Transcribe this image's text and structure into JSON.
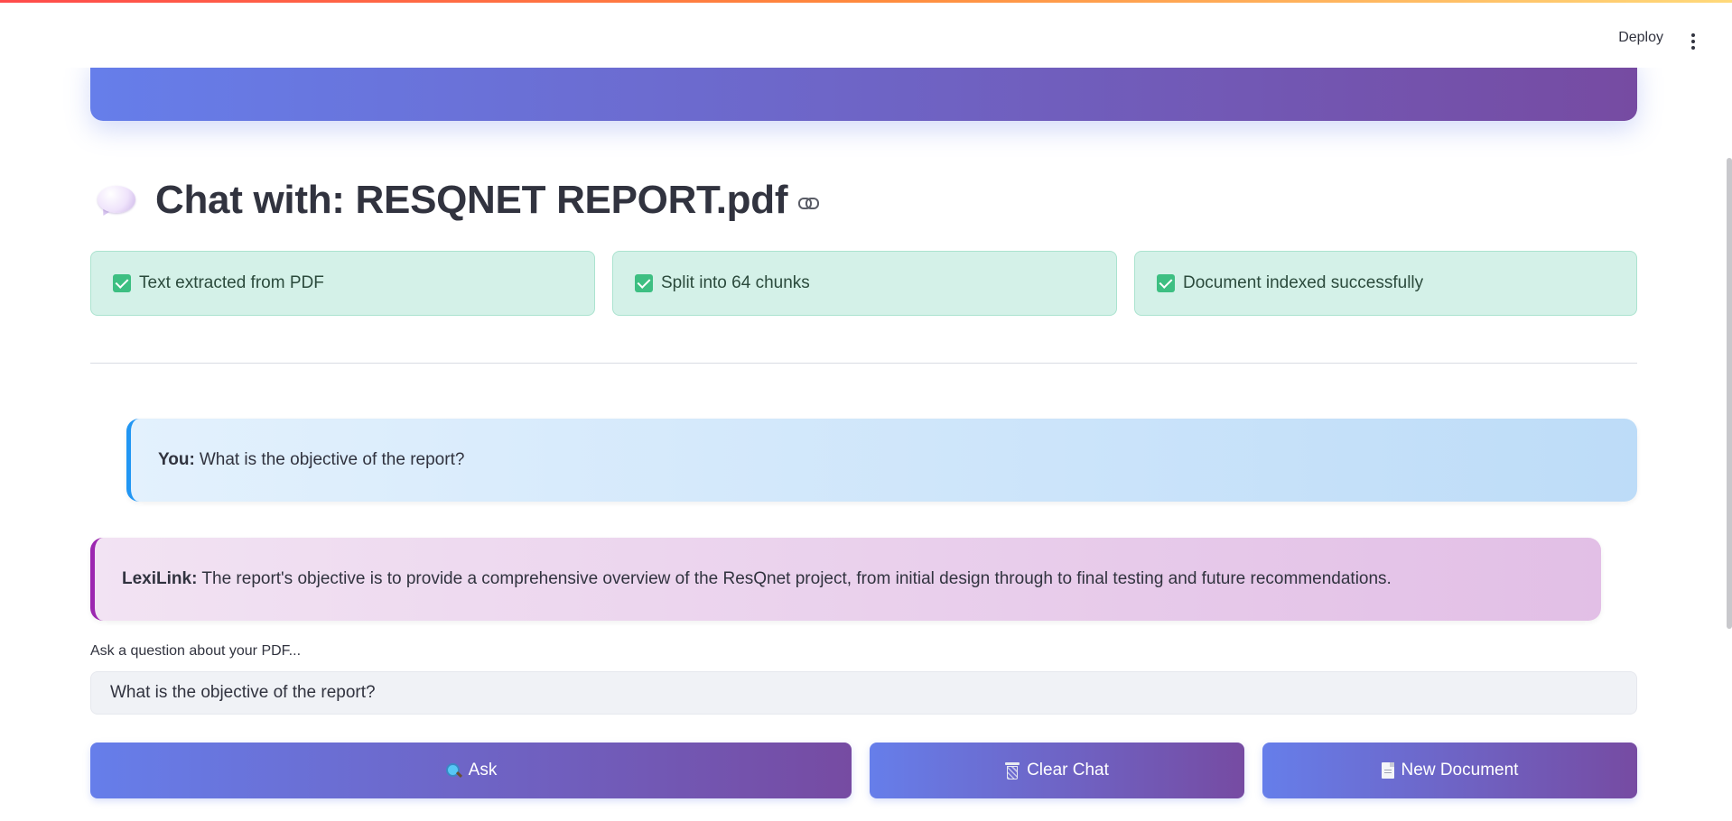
{
  "header": {
    "deploy_label": "Deploy",
    "menu_icon": "kebab-menu-icon"
  },
  "title": {
    "icon": "speech-bubble-icon",
    "text": "Chat with: RESQNET REPORT.pdf",
    "anchor_icon": "link-icon"
  },
  "status_cards": [
    {
      "icon": "check-box-icon",
      "text": "Text extracted from PDF"
    },
    {
      "icon": "check-box-icon",
      "text": "Split into 64 chunks"
    },
    {
      "icon": "check-box-icon",
      "text": "Document indexed successfully"
    }
  ],
  "chat": {
    "messages": [
      {
        "sender": "You:",
        "text": "What is the objective of the report?",
        "accent": "#2196f3"
      },
      {
        "sender": "LexiLink:",
        "text": "The report's objective is to provide a comprehensive overview of the ResQnet project, from initial design through to final testing and future recommendations.",
        "accent": "#9c27b0"
      }
    ]
  },
  "question_input": {
    "label": "Ask a question about your PDF...",
    "value": "What is the objective of the report?"
  },
  "buttons": {
    "ask": {
      "icon": "magnifying-glass-icon",
      "label": "Ask"
    },
    "clear": {
      "icon": "wastebasket-icon",
      "label": "Clear Chat"
    },
    "new_doc": {
      "icon": "document-icon",
      "label": "New Document"
    }
  },
  "colors": {
    "gradient_start": "#667eea",
    "gradient_end": "#764ba2",
    "success_bg": "#d4f1e8",
    "user_accent": "#2196f3",
    "bot_accent": "#9c27b0"
  }
}
